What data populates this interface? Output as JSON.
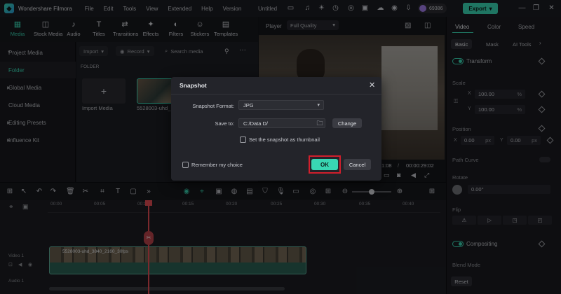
{
  "app": {
    "name": "Wondershare Filmora",
    "menus": [
      "File",
      "Edit",
      "Tools",
      "View",
      "Extended",
      "Help",
      "Version"
    ],
    "project_name": "Untitled",
    "credits": "69386",
    "export_label": "Export",
    "accent": "#39d6b3"
  },
  "media_tabs": [
    {
      "label": "Media",
      "icon": "media-icon"
    },
    {
      "label": "Stock Media",
      "icon": "stock-media-icon"
    },
    {
      "label": "Audio",
      "icon": "audio-icon"
    },
    {
      "label": "Titles",
      "icon": "titles-icon"
    },
    {
      "label": "Transitions",
      "icon": "transitions-icon"
    },
    {
      "label": "Effects",
      "icon": "effects-icon"
    },
    {
      "label": "Filters",
      "icon": "filters-icon"
    },
    {
      "label": "Stickers",
      "icon": "stickers-icon"
    },
    {
      "label": "Templates",
      "icon": "templates-icon"
    }
  ],
  "left_panel": {
    "items": [
      "Project Media",
      "Folder",
      "Global Media",
      "Cloud Media",
      "Editing Presets",
      "Influence Kit"
    ]
  },
  "media_area": {
    "import_label": "Import",
    "record_label": "Record",
    "search_placeholder": "Search media",
    "folder_heading": "FOLDER",
    "import_tile_label": "Import Media",
    "clip_name": "5528003-uhd_"
  },
  "player": {
    "label": "Player",
    "quality": "Full Quality",
    "time_current": "1:08",
    "time_total": "00:00:29:02"
  },
  "right_panel": {
    "tabs": [
      "Video",
      "Color",
      "Speed"
    ],
    "subtabs": [
      "Basic",
      "Mask",
      "AI Tools"
    ],
    "transform": "Transform",
    "scale_label": "Scale",
    "scale_x": "100.00",
    "scale_y": "100.00",
    "percent": "%",
    "position_label": "Position",
    "pos_x": "0.00",
    "pos_y": "0.00",
    "px": "px",
    "path_curve": "Path Curve",
    "rotate_label": "Rotate",
    "rotate_value": "0.00°",
    "flip_label": "Flip",
    "compositing": "Compositing",
    "blend_mode": "Blend Mode",
    "reset": "Reset",
    "x": "X",
    "y": "Y"
  },
  "timeline": {
    "ticks": [
      "00:00",
      "00:05",
      "00:10",
      "00:15",
      "00:20",
      "00:25",
      "00:30",
      "00:35",
      "00:40"
    ],
    "video_track": "Video 1",
    "audio_track": "Audio 1",
    "clip_label": "5528003-uhd_3840_2160_30fps"
  },
  "dialog": {
    "title": "Snapshot",
    "format_label": "Snapshot Format:",
    "format_value": "JPG",
    "save_to_label": "Save to:",
    "save_to_value": "C:/Data D/",
    "change_label": "Change",
    "thumbnail_label": "Set the snapshot as thumbnail",
    "thumbnail_checked": false,
    "remember_label": "Remember my choice",
    "remember_checked": false,
    "ok_label": "OK",
    "cancel_label": "Cancel"
  }
}
